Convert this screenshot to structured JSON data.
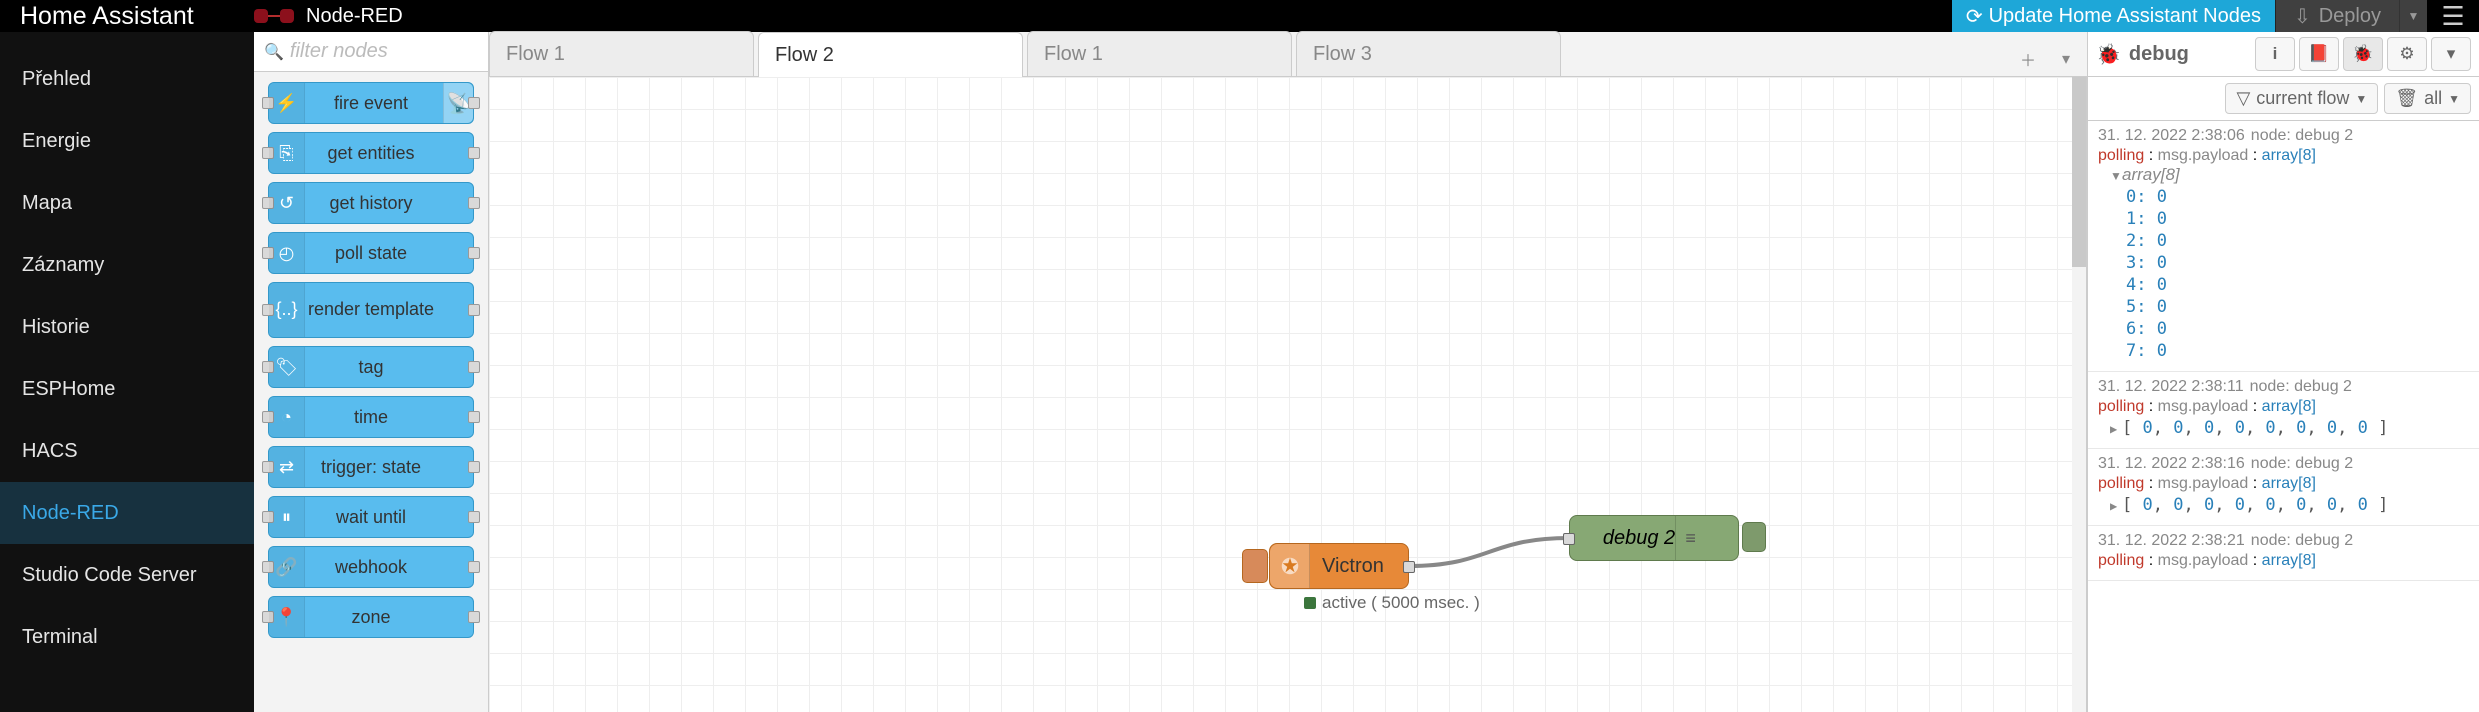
{
  "header": {
    "ha_title": "Home Assistant",
    "nr_title": "Node-RED",
    "update_btn": "Update Home Assistant Nodes",
    "deploy_btn": "Deploy"
  },
  "ha_sidebar": {
    "items": [
      {
        "label": "Přehled"
      },
      {
        "label": "Energie"
      },
      {
        "label": "Mapa"
      },
      {
        "label": "Záznamy"
      },
      {
        "label": "Historie"
      },
      {
        "label": "ESPHome"
      },
      {
        "label": "HACS"
      },
      {
        "label": "Node-RED",
        "active": true
      },
      {
        "label": "Studio Code Server"
      },
      {
        "label": "Terminal"
      }
    ]
  },
  "palette": {
    "search_placeholder": "filter nodes",
    "nodes": [
      {
        "label": "fire event",
        "icon": "⚡",
        "badge": true
      },
      {
        "label": "get entities",
        "icon": "⎘"
      },
      {
        "label": "get history",
        "icon": "↺"
      },
      {
        "label": "poll state",
        "icon": "◴"
      },
      {
        "label": "render template",
        "icon": "{..}",
        "big": true
      },
      {
        "label": "tag",
        "icon": "🏷"
      },
      {
        "label": "time",
        "icon": "◔"
      },
      {
        "label": "trigger: state",
        "icon": "⇄"
      },
      {
        "label": "wait until",
        "icon": "⏸"
      },
      {
        "label": "webhook",
        "icon": "🔗"
      },
      {
        "label": "zone",
        "icon": "📍"
      }
    ]
  },
  "tabs": {
    "items": [
      {
        "label": "Flow 1"
      },
      {
        "label": "Flow 2",
        "active": true
      },
      {
        "label": "Flow 1"
      },
      {
        "label": "Flow 3"
      }
    ]
  },
  "canvas": {
    "victron_label": "Victron",
    "debug_label": "debug 2",
    "status_text": "active ( 5000 msec. )"
  },
  "debug": {
    "title": "debug",
    "filter_label": "current flow",
    "clear_label": "all",
    "messages": [
      {
        "time": "31. 12. 2022 2:38:06",
        "node": "node: debug 2",
        "topic": "polling",
        "prop": "msg.payload",
        "type": "array[8]",
        "expanded": true,
        "header": "array[8]",
        "array": [
          {
            "k": "0",
            "v": "0"
          },
          {
            "k": "1",
            "v": "0"
          },
          {
            "k": "2",
            "v": "0"
          },
          {
            "k": "3",
            "v": "0"
          },
          {
            "k": "4",
            "v": "0"
          },
          {
            "k": "5",
            "v": "0"
          },
          {
            "k": "6",
            "v": "0"
          },
          {
            "k": "7",
            "v": "0"
          }
        ]
      },
      {
        "time": "31. 12. 2022 2:38:11",
        "node": "node: debug 2",
        "topic": "polling",
        "prop": "msg.payload",
        "type": "array[8]",
        "inline": "[ 0, 0, 0, 0, 0, 0, 0, 0 ]"
      },
      {
        "time": "31. 12. 2022 2:38:16",
        "node": "node: debug 2",
        "topic": "polling",
        "prop": "msg.payload",
        "type": "array[8]",
        "inline": "[ 0, 0, 0, 0, 0, 0, 0, 0 ]"
      },
      {
        "time": "31. 12. 2022 2:38:21",
        "node": "node: debug 2",
        "topic": "polling",
        "prop": "msg.payload",
        "type": "array[8]"
      }
    ]
  }
}
